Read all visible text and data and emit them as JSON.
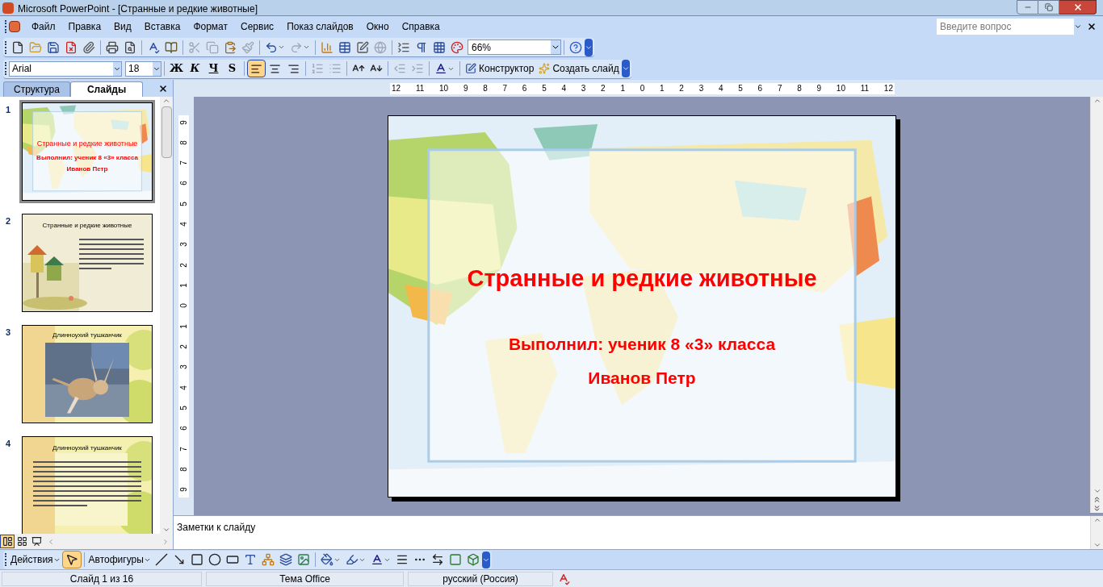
{
  "window": {
    "title": "Microsoft PowerPoint - [Странные и редкие животные]"
  },
  "menu": [
    "Файл",
    "Правка",
    "Вид",
    "Вставка",
    "Формат",
    "Сервис",
    "Показ слайдов",
    "Окно",
    "Справка"
  ],
  "help_search": {
    "placeholder": "Введите вопрос"
  },
  "standard_toolbar": {
    "zoom": "66%"
  },
  "formatting_toolbar": {
    "font": "Arial",
    "size": "18",
    "styles": [
      "Ж",
      "К",
      "Ч",
      "S"
    ],
    "align": [
      {
        "selected": true
      },
      {
        "selected": false
      },
      {
        "selected": false
      }
    ],
    "designer": "Конструктор",
    "new_slide": "Создать слайд"
  },
  "pane_tabs": [
    {
      "label": "Структура",
      "selected": false
    },
    {
      "label": "Слайды",
      "selected": true
    }
  ],
  "ruler": {
    "horizontal": [
      "12",
      "11",
      "10",
      "9",
      "8",
      "7",
      "6",
      "5",
      "4",
      "3",
      "2",
      "1",
      "0",
      "1",
      "2",
      "3",
      "4",
      "5",
      "6",
      "7",
      "8",
      "9",
      "10",
      "11",
      "12"
    ],
    "vertical": [
      "9",
      "8",
      "7",
      "6",
      "5",
      "4",
      "3",
      "2",
      "1",
      "0",
      "1",
      "2",
      "3",
      "4",
      "5",
      "6",
      "7",
      "8",
      "9"
    ]
  },
  "thumbnails": [
    {
      "number": "1",
      "kind": "map",
      "selected": true,
      "title": "Странные и редкие животные",
      "lines": [
        "Выполнил: ученик 8 «3» класса",
        "Иванов Петр"
      ]
    },
    {
      "number": "2",
      "kind": "garden",
      "selected": false,
      "title": "Странные и редкие животные"
    },
    {
      "number": "3",
      "selected": false,
      "title": "Длинноухий тушканчик"
    },
    {
      "number": "4",
      "kind": "text",
      "selected": false,
      "title": "Длинноухий тушканчик"
    }
  ],
  "slide": {
    "title": "Странные и редкие животные",
    "lines": [
      "Выполнил: ученик 8 «3» класса",
      "Иванов Петр"
    ]
  },
  "notes": {
    "placeholder": "Заметки к слайду"
  },
  "view_buttons": [
    {
      "selected": true
    },
    {
      "selected": false
    },
    {
      "selected": false
    }
  ],
  "drawing_toolbar": {
    "actions": "Действия",
    "autoshapes": "Автофигуры"
  },
  "status_bar": [
    "Слайд 1 из 16",
    "Тема Office",
    "русский (Россия)"
  ]
}
